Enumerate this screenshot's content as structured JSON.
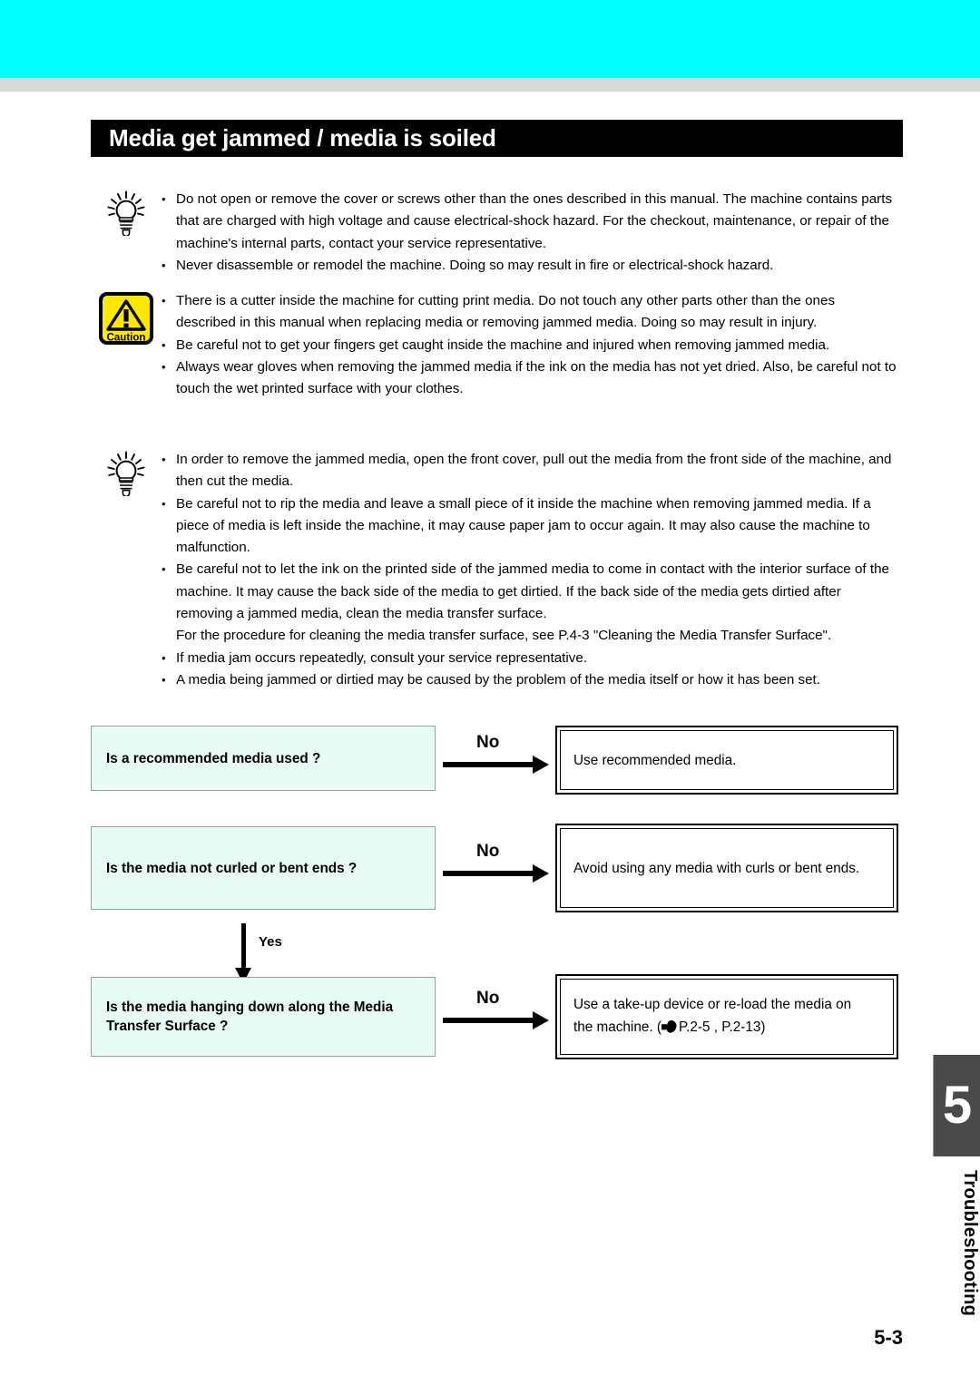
{
  "header": {
    "running_title": "Troubleshooting",
    "band_color": "#00FFFF",
    "divider_color": "#d8d8d8"
  },
  "section": {
    "title": "Media get jammed / media is soiled"
  },
  "notices": [
    {
      "icon": "lightbulb-hint-icon",
      "bullets": [
        "Do not open or remove the cover or screws other than the ones described in this manual. The machine contains parts that are charged with high voltage and cause electrical-shock hazard. For the checkout, maintenance, or repair of the machine's internal parts, contact your service representative.",
        "Never disassemble or remodel the machine. Doing so may result in fire or electrical-shock hazard."
      ]
    },
    {
      "icon": "caution-warning-icon",
      "icon_label": "Caution",
      "bullets": [
        "There is a cutter inside the machine for cutting print media. Do not touch any other parts other than the ones described in this manual when replacing media or removing jammed media. Doing so may result in injury.",
        "Be careful not to get your fingers get caught inside the machine and injured when removing jammed media.",
        "Always wear gloves when removing the jammed media if the ink on the media has not yet dried. Also, be careful not to touch the wet printed surface with your clothes."
      ]
    },
    {
      "icon": "lightbulb-hint-icon",
      "bullets": [
        "In order to remove the jammed media, open the front cover, pull out the media from the front side of the machine, and then cut the media.",
        "Be careful not to rip the media and leave a small piece of it inside the machine when removing jammed media. If a piece of media is left inside the machine, it may cause paper jam to occur again. It may also cause the machine to malfunction.",
        "Be careful not to let the ink on the printed side of the jammed media to come in contact with the interior surface of the machine. It may cause the back side of the media to get dirtied. If the back side of the media gets dirtied after removing a jammed media, clean the media transfer surface.",
        "If media jam occurs repeatedly, consult your service representative.",
        "A media being jammed or dirtied may be caused by the problem of the media itself or how it has been set."
      ],
      "continuation_line": "For the procedure for cleaning the media transfer surface, see P.4-3 \"Cleaning the Media Transfer Surface\"."
    }
  ],
  "flowchart": {
    "question_box_fill": "#E9FBF5",
    "steps": [
      {
        "question": "Is a recommended media used ?",
        "branch_label": "No",
        "answer": "Use recommended media.",
        "answer_ref": ""
      },
      {
        "question": "Is the media not curled or bent ends ?",
        "branch_label": "No",
        "answer": "Avoid using any media with curls or bent ends.",
        "answer_ref": ""
      },
      {
        "question_line1": "Is the media hanging down along the Media",
        "question_line2": "Transfer Surface ?",
        "branch_label": "No",
        "answer_line1": "Use a take-up device or re-load the media on",
        "answer_line2_prefix": "the machine. (",
        "answer_ref": "P.2-5 , P.2-13)",
        "ref_icon": "pointing-hand-icon"
      }
    ],
    "yes_label": "Yes"
  },
  "side_tab": {
    "chapter_number": "5",
    "chapter_label": "Troubleshooting",
    "box_color": "#4a4a4a"
  },
  "footer": {
    "page_number": "5-3"
  }
}
